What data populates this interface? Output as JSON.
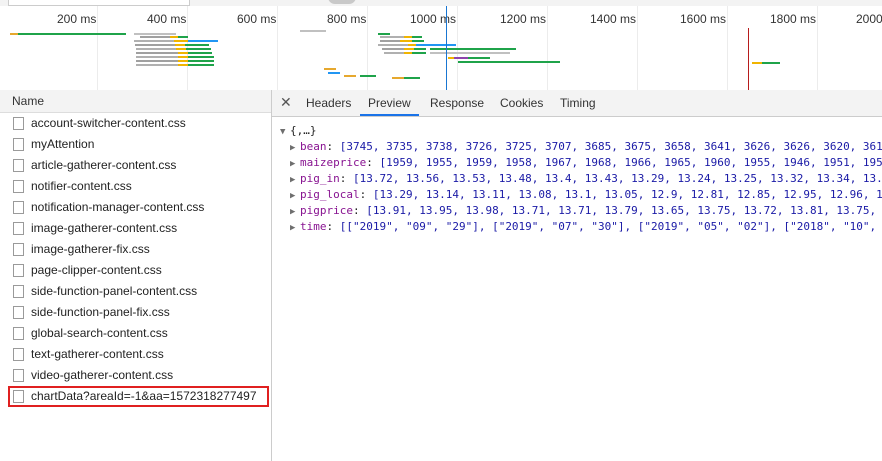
{
  "timeline": {
    "ticks": [
      "200 ms",
      "400 ms",
      "600 ms",
      "800 ms",
      "1000 ms",
      "1200 ms",
      "1400 ms",
      "1600 ms",
      "1800 ms",
      "2000"
    ]
  },
  "network": {
    "name_header": "Name",
    "requests": [
      {
        "name": "account-switcher-content.css"
      },
      {
        "name": "myAttention"
      },
      {
        "name": "article-gatherer-content.css"
      },
      {
        "name": "notifier-content.css"
      },
      {
        "name": "notification-manager-content.css"
      },
      {
        "name": "image-gatherer-content.css"
      },
      {
        "name": "image-gatherer-fix.css"
      },
      {
        "name": "page-clipper-content.css"
      },
      {
        "name": "side-function-panel-content.css"
      },
      {
        "name": "side-function-panel-fix.css"
      },
      {
        "name": "global-search-content.css"
      },
      {
        "name": "text-gatherer-content.css"
      },
      {
        "name": "video-gatherer-content.css"
      },
      {
        "name": "chartData?areaId=-1&aa=1572318277497",
        "selected": true
      }
    ]
  },
  "detail": {
    "close": "✕",
    "tabs": [
      "Headers",
      "Preview",
      "Response",
      "Cookies",
      "Timing"
    ],
    "active_tab": "Preview",
    "preview": {
      "root": "{,…}",
      "lines": [
        {
          "key": "bean",
          "value": "[3745, 3735, 3738, 3726, 3725, 3707, 3685, 3675, 3658, 3641, 3626, 3626, 3620, 361"
        },
        {
          "key": "maizeprice",
          "value": "[1959, 1955, 1959, 1958, 1967, 1968, 1966, 1965, 1960, 1955, 1946, 1951, 195"
        },
        {
          "key": "pig_in",
          "value": "[13.72, 13.56, 13.53, 13.48, 13.4, 13.43, 13.29, 13.24, 13.25, 13.32, 13.34, 13."
        },
        {
          "key": "pig_local",
          "value": "[13.29, 13.14, 13.11, 13.08, 13.1, 13.05, 12.9, 12.81, 12.85, 12.95, 12.96, 1"
        },
        {
          "key": "pigprice",
          "value": "[13.91, 13.95, 13.98, 13.71, 13.71, 13.79, 13.65, 13.75, 13.72, 13.81, 13.75,"
        },
        {
          "key": "time",
          "value": "[[\"2019\", \"09\", \"29\"], [\"2019\", \"07\", \"30\"], [\"2019\", \"05\", \"02\"], [\"2018\", \"10\","
        }
      ]
    }
  }
}
